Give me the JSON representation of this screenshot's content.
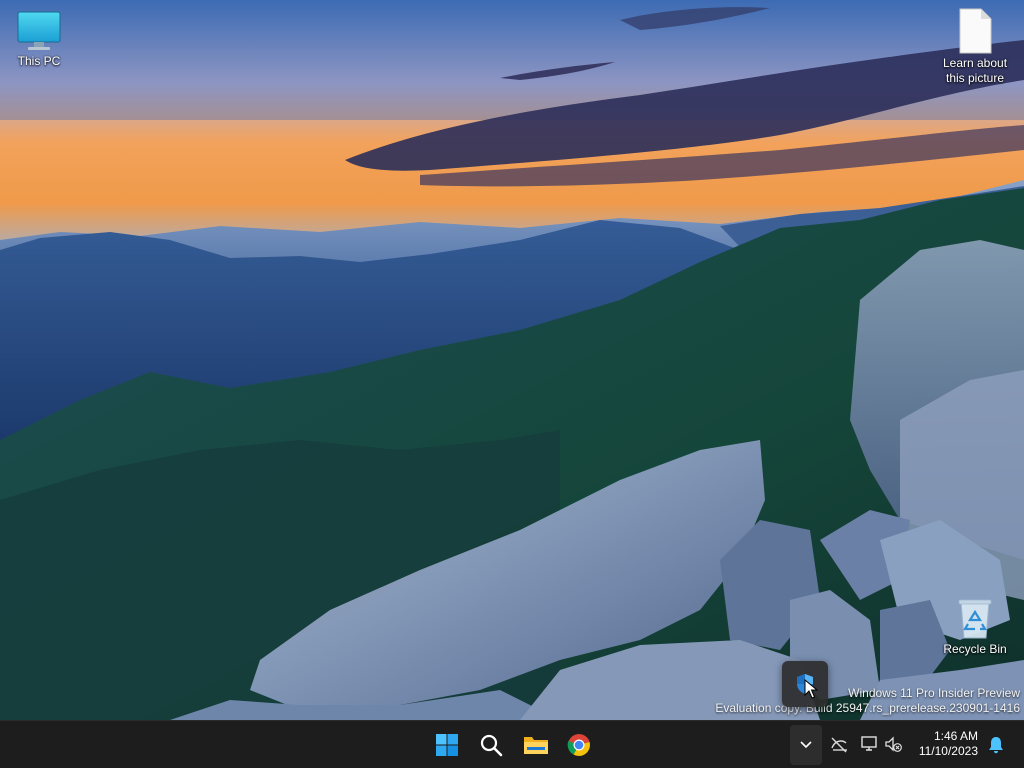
{
  "desktop": {
    "icons": [
      {
        "label": "This PC",
        "icon": "monitor-icon"
      },
      {
        "label": "Learn about this picture",
        "icon": "document-icon"
      },
      {
        "label": "Recycle Bin",
        "icon": "recycle-bin-icon"
      }
    ],
    "watermark": {
      "line1": "Windows 11 Pro Insider Preview",
      "line2": "Evaluation copy. Build 25947.rs_prerelease.230901-1416"
    }
  },
  "taskbar": {
    "pinned": [
      {
        "name": "Start",
        "icon": "windows-logo-icon"
      },
      {
        "name": "Search",
        "icon": "search-icon"
      },
      {
        "name": "File Explorer",
        "icon": "folder-icon"
      },
      {
        "name": "Google Chrome",
        "icon": "chrome-icon"
      }
    ],
    "tray": {
      "chevron_icon": "chevron-down-icon",
      "icons": [
        "network-disconnected-icon",
        "display-icon",
        "volume-muted-icon",
        "notification-bell-icon"
      ]
    },
    "clock": {
      "time": "1:46 AM",
      "date": "11/10/2023"
    }
  },
  "colors": {
    "taskbar_bg": "#1d1d1d",
    "accent": "#0078d4"
  }
}
